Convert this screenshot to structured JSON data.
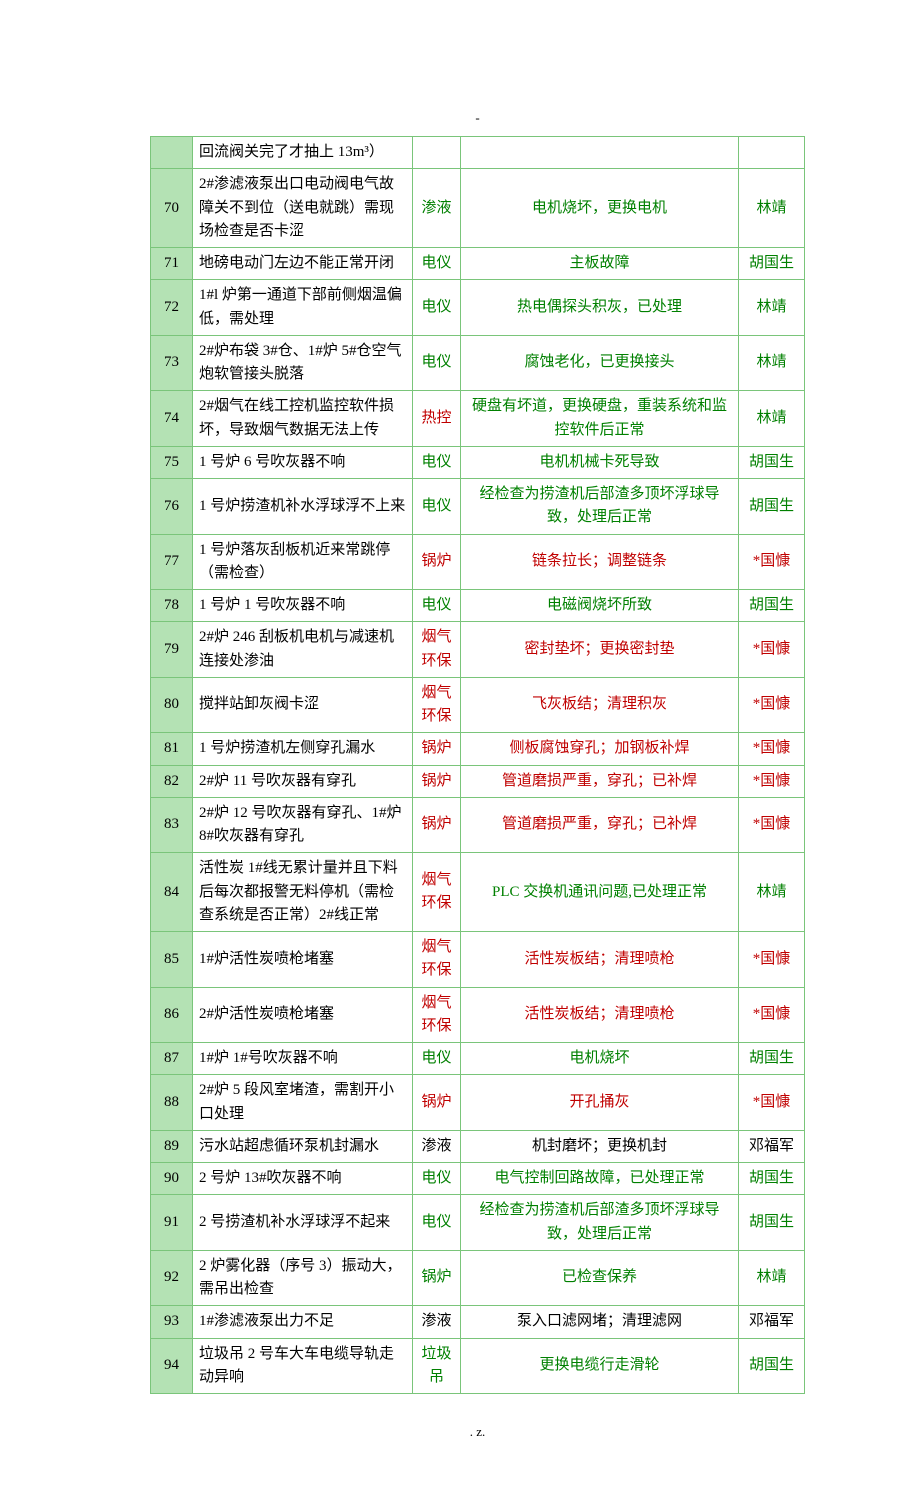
{
  "header_mark": "-",
  "footer_mark": ".                                         z.",
  "rows": [
    {
      "n": "",
      "desc": "回流阀关完了才抽上 13m³）",
      "cat": "",
      "catc": "",
      "sol": "",
      "solc": "",
      "per": "",
      "perc": ""
    },
    {
      "n": "70",
      "desc": "2#渗滤液泵出口电动阀电气故障关不到位（送电就跳）需现场检查是否卡涩",
      "cat": "渗液",
      "catc": "gr",
      "sol": "电机烧坏，更换电机",
      "solc": "gr",
      "per": "林靖",
      "perc": "gr"
    },
    {
      "n": "71",
      "desc": "地磅电动门左边不能正常开闭",
      "cat": "电仪",
      "catc": "gr",
      "sol": "主板故障",
      "solc": "gr",
      "per": "胡国生",
      "perc": "gr"
    },
    {
      "n": "72",
      "desc": "1#l 炉第一通道下部前侧烟温偏低，需处理",
      "cat": "电仪",
      "catc": "gr",
      "sol": "热电偶探头积灰，已处理",
      "solc": "gr",
      "per": "林靖",
      "perc": "gr"
    },
    {
      "n": "73",
      "desc": "2#炉布袋 3#仓、1#炉 5#仓空气炮软管接头脱落",
      "cat": "电仪",
      "catc": "gr",
      "sol": "腐蚀老化，已更换接头",
      "solc": "gr",
      "per": "林靖",
      "perc": "gr"
    },
    {
      "n": "74",
      "desc": "2#烟气在线工控机监控软件损坏，导致烟气数据无法上传",
      "cat": "热控",
      "catc": "rd",
      "sol": "硬盘有坏道，更换硬盘，重装系统和监控软件后正常",
      "solc": "gr",
      "per": "林靖",
      "perc": "gr"
    },
    {
      "n": "75",
      "desc": "1 号炉 6 号吹灰器不响",
      "cat": "电仪",
      "catc": "gr",
      "sol": "电机机械卡死导致",
      "solc": "gr",
      "per": "胡国生",
      "perc": "gr"
    },
    {
      "n": "76",
      "desc": "1 号炉捞渣机补水浮球浮不上来",
      "cat": "电仪",
      "catc": "gr",
      "sol": "经检查为捞渣机后部渣多顶坏浮球导致，处理后正常",
      "solc": "gr",
      "per": "胡国生",
      "perc": "gr"
    },
    {
      "n": "77",
      "desc": "1 号炉落灰刮板机近来常跳停（需检查）",
      "cat": "锅炉",
      "catc": "rd",
      "sol": "链条拉长；调整链条",
      "solc": "rd",
      "per": "*国慷",
      "perc": "rd"
    },
    {
      "n": "78",
      "desc": "1 号炉 1 号吹灰器不响",
      "cat": "电仪",
      "catc": "gr",
      "sol": "电磁阀烧坏所致",
      "solc": "gr",
      "per": "胡国生",
      "perc": "gr"
    },
    {
      "n": "79",
      "desc": "2#炉 246 刮板机电机与减速机连接处渗油",
      "cat": "烟气环保",
      "catc": "rd",
      "sol": "密封垫坏；更换密封垫",
      "solc": "rd",
      "per": "*国慷",
      "perc": "rd"
    },
    {
      "n": "80",
      "desc": "搅拌站卸灰阀卡涩",
      "cat": "烟气环保",
      "catc": "rd",
      "sol": "飞灰板结；清理积灰",
      "solc": "rd",
      "per": "*国慷",
      "perc": "rd"
    },
    {
      "n": "81",
      "desc": "1 号炉捞渣机左侧穿孔漏水",
      "cat": "锅炉",
      "catc": "rd",
      "sol": "侧板腐蚀穿孔；加钢板补焊",
      "solc": "rd",
      "per": "*国慷",
      "perc": "rd"
    },
    {
      "n": "82",
      "desc": "2#炉 11 号吹灰器有穿孔",
      "cat": "锅炉",
      "catc": "rd",
      "sol": "管道磨损严重，穿孔；已补焊",
      "solc": "rd",
      "per": "*国慷",
      "perc": "rd"
    },
    {
      "n": "83",
      "desc": "2#炉 12 号吹灰器有穿孔、1#炉 8#吹灰器有穿孔",
      "cat": "锅炉",
      "catc": "rd",
      "sol": "管道磨损严重，穿孔；已补焊",
      "solc": "rd",
      "per": "*国慷",
      "perc": "rd"
    },
    {
      "n": "84",
      "desc": "活性炭 1#线无累计量并且下料后每次都报警无料停机（需检查系统是否正常）2#线正常",
      "cat": "烟气环保",
      "catc": "rd",
      "sol": "PLC 交换机通讯问题,已处理正常",
      "solc": "gr",
      "per": "林靖",
      "perc": "gr"
    },
    {
      "n": "85",
      "desc": "1#炉活性炭喷枪堵塞",
      "cat": "烟气环保",
      "catc": "rd",
      "sol": "活性炭板结；清理喷枪",
      "solc": "rd",
      "per": "*国慷",
      "perc": "rd"
    },
    {
      "n": "86",
      "desc": "2#炉活性炭喷枪堵塞",
      "cat": "烟气环保",
      "catc": "rd",
      "sol": "活性炭板结；清理喷枪",
      "solc": "rd",
      "per": "*国慷",
      "perc": "rd"
    },
    {
      "n": "87",
      "desc": "1#炉 1#号吹灰器不响",
      "cat": "电仪",
      "catc": "gr",
      "sol": "电机烧坏",
      "solc": "gr",
      "per": "胡国生",
      "perc": "gr"
    },
    {
      "n": "88",
      "desc": "2#炉 5 段风室堵渣，需割开小口处理",
      "cat": "锅炉",
      "catc": "rd",
      "sol": "开孔捅灰",
      "solc": "rd",
      "per": "*国慷",
      "perc": "rd"
    },
    {
      "n": "89",
      "desc": "污水站超虑循环泵机封漏水",
      "cat": "渗液",
      "catc": "bk",
      "sol": "机封磨坏；更换机封",
      "solc": "bk",
      "per": "邓福军",
      "perc": "bk"
    },
    {
      "n": "90",
      "desc": "2 号炉 13#吹灰器不响",
      "cat": "电仪",
      "catc": "gr",
      "sol": "电气控制回路故障，已处理正常",
      "solc": "gr",
      "per": "胡国生",
      "perc": "gr"
    },
    {
      "n": "91",
      "desc": "2 号捞渣机补水浮球浮不起来",
      "cat": "电仪",
      "catc": "gr",
      "sol": "经检查为捞渣机后部渣多顶坏浮球导致，处理后正常",
      "solc": "gr",
      "per": "胡国生",
      "perc": "gr"
    },
    {
      "n": "92",
      "desc": "2 炉雾化器（序号 3）振动大，需吊出检查",
      "cat": "锅炉",
      "catc": "gr",
      "sol": "已检查保养",
      "solc": "gr",
      "per": "林靖",
      "perc": "gr"
    },
    {
      "n": "93",
      "desc": "1#渗滤液泵出力不足",
      "cat": "渗液",
      "catc": "bk",
      "sol": "泵入口滤网堵；清理滤网",
      "solc": "bk",
      "per": "邓福军",
      "perc": "bk"
    },
    {
      "n": "94",
      "desc": "垃圾吊 2 号车大车电缆导轨走动异响",
      "cat": "垃圾吊",
      "catc": "gr",
      "sol": "更换电缆行走滑轮",
      "solc": "gr",
      "per": "胡国生",
      "perc": "gr"
    }
  ]
}
